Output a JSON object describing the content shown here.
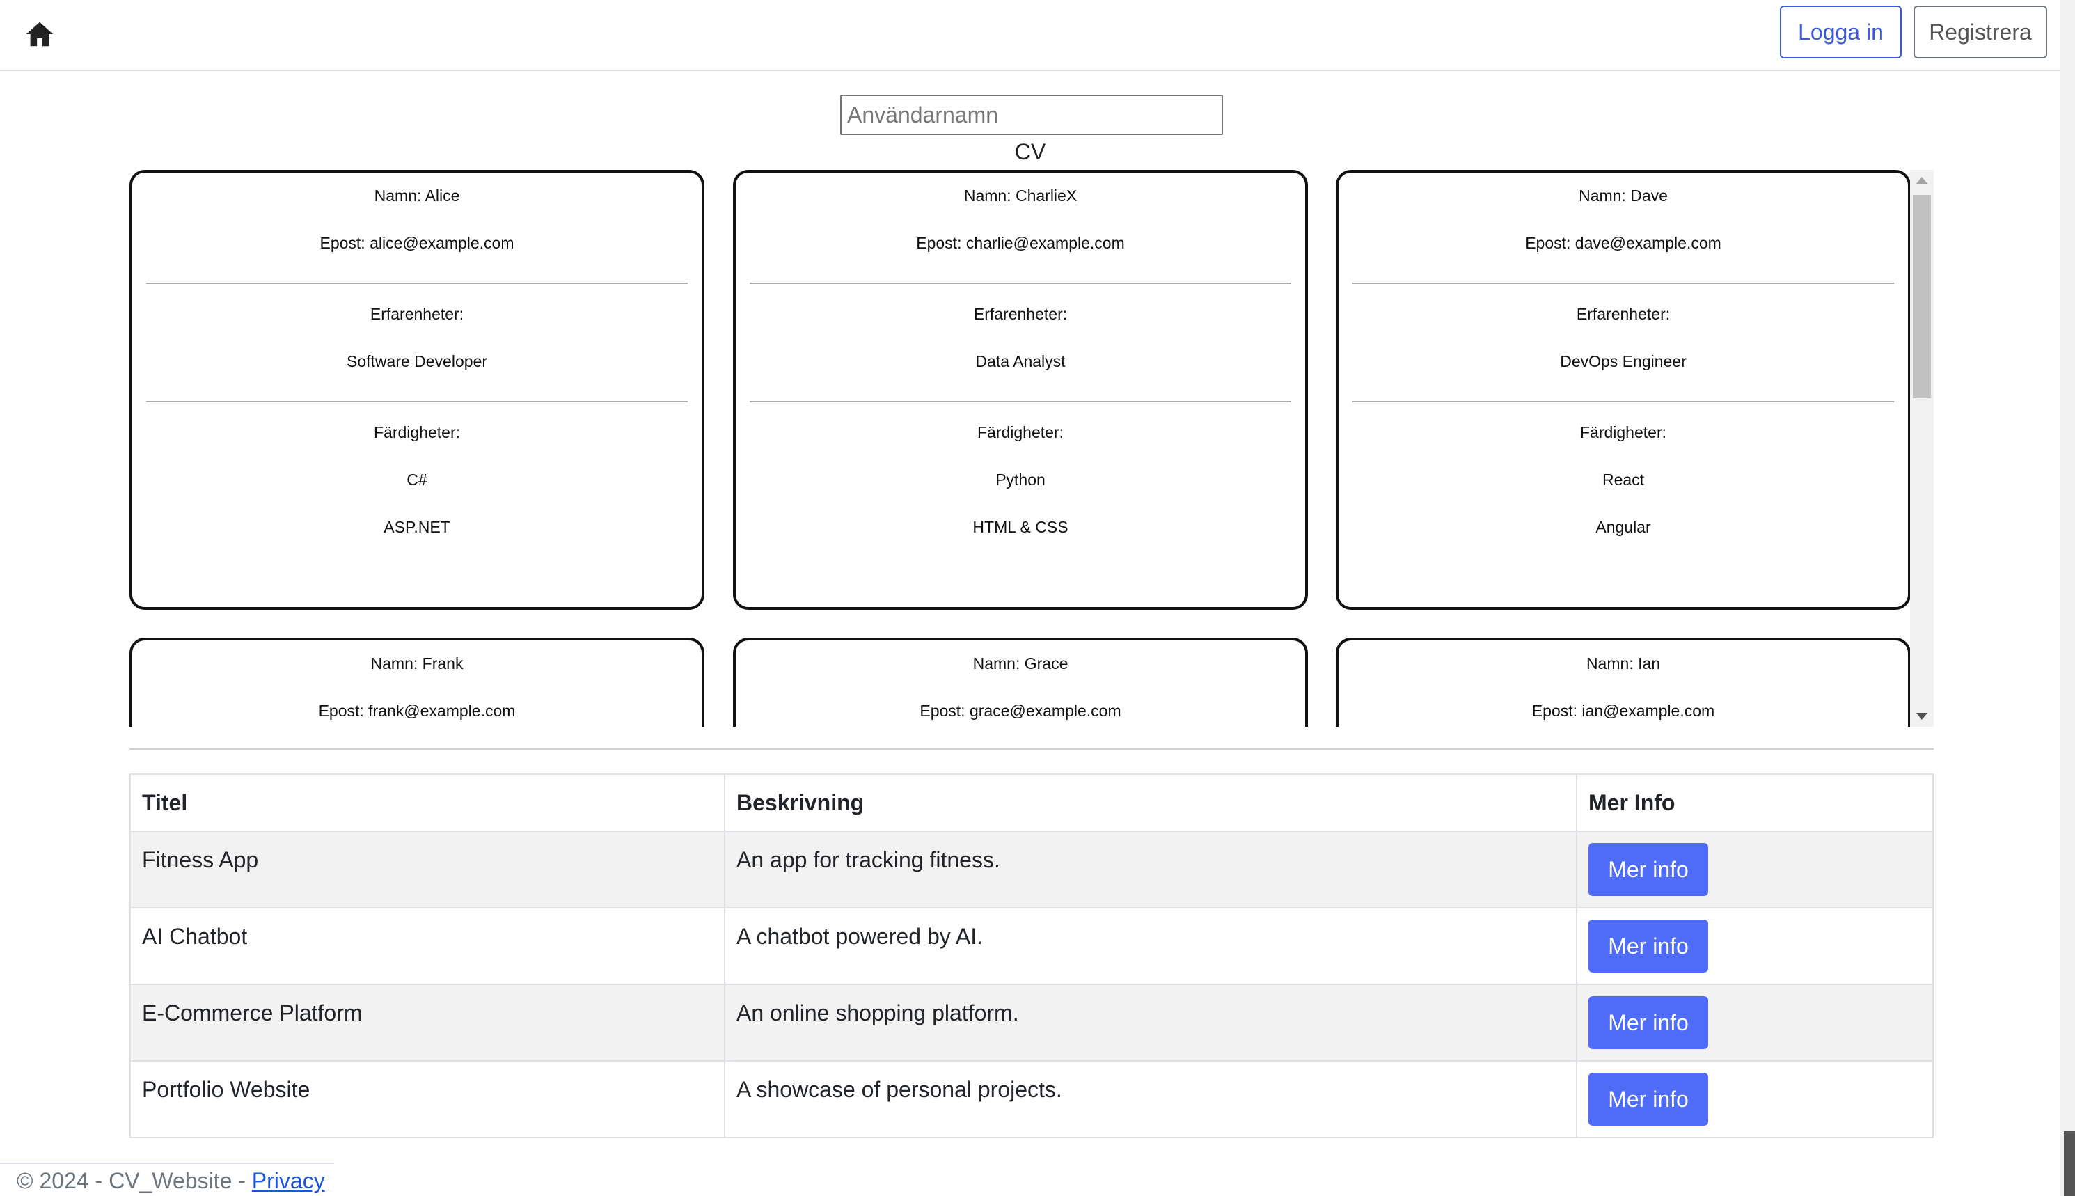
{
  "nav": {
    "home_icon": "home-icon",
    "login_label": "Logga in",
    "register_label": "Registrera"
  },
  "search": {
    "placeholder": "Användarnamn"
  },
  "section_title": "CV",
  "cards": [
    {
      "name": "Namn: Alice",
      "email": "Epost: alice@example.com",
      "exp_label": "Erfarenheter:",
      "experiences": [
        "Software Developer"
      ],
      "skills_label": "Färdigheter:",
      "skills": [
        "C#",
        "ASP.NET"
      ]
    },
    {
      "name": "Namn: CharlieX",
      "email": "Epost: charlie@example.com",
      "exp_label": "Erfarenheter:",
      "experiences": [
        "Data Analyst"
      ],
      "skills_label": "Färdigheter:",
      "skills": [
        "Python",
        "HTML & CSS"
      ]
    },
    {
      "name": "Namn: Dave",
      "email": "Epost: dave@example.com",
      "exp_label": "Erfarenheter:",
      "experiences": [
        "DevOps Engineer"
      ],
      "skills_label": "Färdigheter:",
      "skills": [
        "React",
        "Angular"
      ]
    },
    {
      "name": "Namn: Frank",
      "email": "Epost: frank@example.com"
    },
    {
      "name": "Namn: Grace",
      "email": "Epost: grace@example.com"
    },
    {
      "name": "Namn: Ian",
      "email": "Epost: ian@example.com"
    }
  ],
  "table": {
    "headers": [
      "Titel",
      "Beskrivning",
      "Mer Info"
    ],
    "rows": [
      {
        "title": "Fitness App",
        "description": "An app for tracking fitness.",
        "button": "Mer info"
      },
      {
        "title": "AI Chatbot",
        "description": "A chatbot powered by AI.",
        "button": "Mer info"
      },
      {
        "title": "E-Commerce Platform",
        "description": "An online shopping platform.",
        "button": "Mer info"
      },
      {
        "title": "Portfolio Website",
        "description": "A showcase of personal projects.",
        "button": "Mer info"
      }
    ]
  },
  "footer": {
    "text": "© 2024 - CV_Website - ",
    "link": "Privacy"
  },
  "colors": {
    "primary": "#4e6cf7",
    "login_border": "#3b5bdb"
  }
}
